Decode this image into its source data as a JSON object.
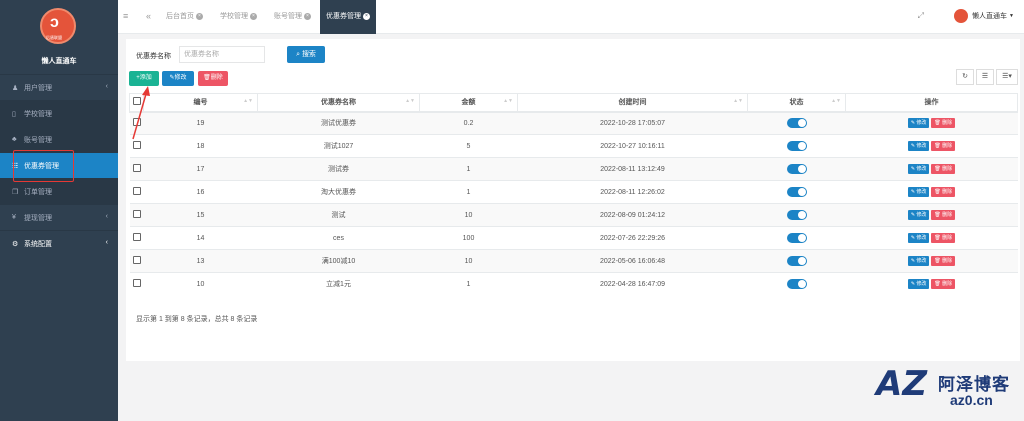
{
  "sidebar": {
    "logo_text": "后盾联盟",
    "brand": "懒人直通车",
    "items": [
      {
        "label": "用户管理",
        "icon": "user-icon",
        "has_arrow": true
      },
      {
        "label": "学校管理",
        "icon": "document-icon",
        "has_arrow": false
      },
      {
        "label": "账号管理",
        "icon": "users-icon",
        "has_arrow": false
      },
      {
        "label": "优惠券管理",
        "icon": "coupon-icon",
        "has_arrow": false
      },
      {
        "label": "订单管理",
        "icon": "copy-icon",
        "has_arrow": false
      },
      {
        "label": "提现管理",
        "icon": "yen-icon",
        "has_arrow": true
      },
      {
        "label": "系统配置",
        "icon": "gear-icon",
        "has_arrow": true
      }
    ]
  },
  "topbar": {
    "tabs": [
      "后台首页",
      "学校管理",
      "账号管理",
      "优惠券管理"
    ],
    "user_name": "懒人直通车"
  },
  "search": {
    "label": "优惠券名称",
    "placeholder": "优惠券名称",
    "button": "搜索"
  },
  "toolbar": {
    "add": "添加",
    "edit": "修改",
    "delete": "删除"
  },
  "table": {
    "headers": [
      "编号",
      "优惠券名称",
      "金额",
      "创建时间",
      "状态",
      "操作"
    ],
    "rows": [
      {
        "id": "19",
        "name": "测试优惠券",
        "amount": "0.2",
        "created": "2022-10-28 17:05:07"
      },
      {
        "id": "18",
        "name": "测试1027",
        "amount": "5",
        "created": "2022-10-27 10:16:11"
      },
      {
        "id": "17",
        "name": "测试券",
        "amount": "1",
        "created": "2022-08-11 13:12:49"
      },
      {
        "id": "16",
        "name": "淘大优惠券",
        "amount": "1",
        "created": "2022-08-11 12:26:02"
      },
      {
        "id": "15",
        "name": "测试",
        "amount": "10",
        "created": "2022-08-09 01:24:12"
      },
      {
        "id": "14",
        "name": "ces",
        "amount": "100",
        "created": "2022-07-26 22:29:26"
      },
      {
        "id": "13",
        "name": "满100减10",
        "amount": "10",
        "created": "2022-05-06 16:06:48"
      },
      {
        "id": "10",
        "name": "立减1元",
        "amount": "1",
        "created": "2022-04-28 16:47:09"
      }
    ],
    "row_edit": "修改",
    "row_delete": "删除"
  },
  "pagination": "显示第 1 到第 8 条记录，总共 8 条记录",
  "watermark": {
    "logo": "AZ",
    "name": "阿泽博客",
    "url": "az0.cn"
  },
  "colors": {
    "sidebar": "#2f4050",
    "primary": "#1c84c6",
    "success": "#1ab394",
    "danger": "#ed5565",
    "annotation": "#e53935"
  }
}
